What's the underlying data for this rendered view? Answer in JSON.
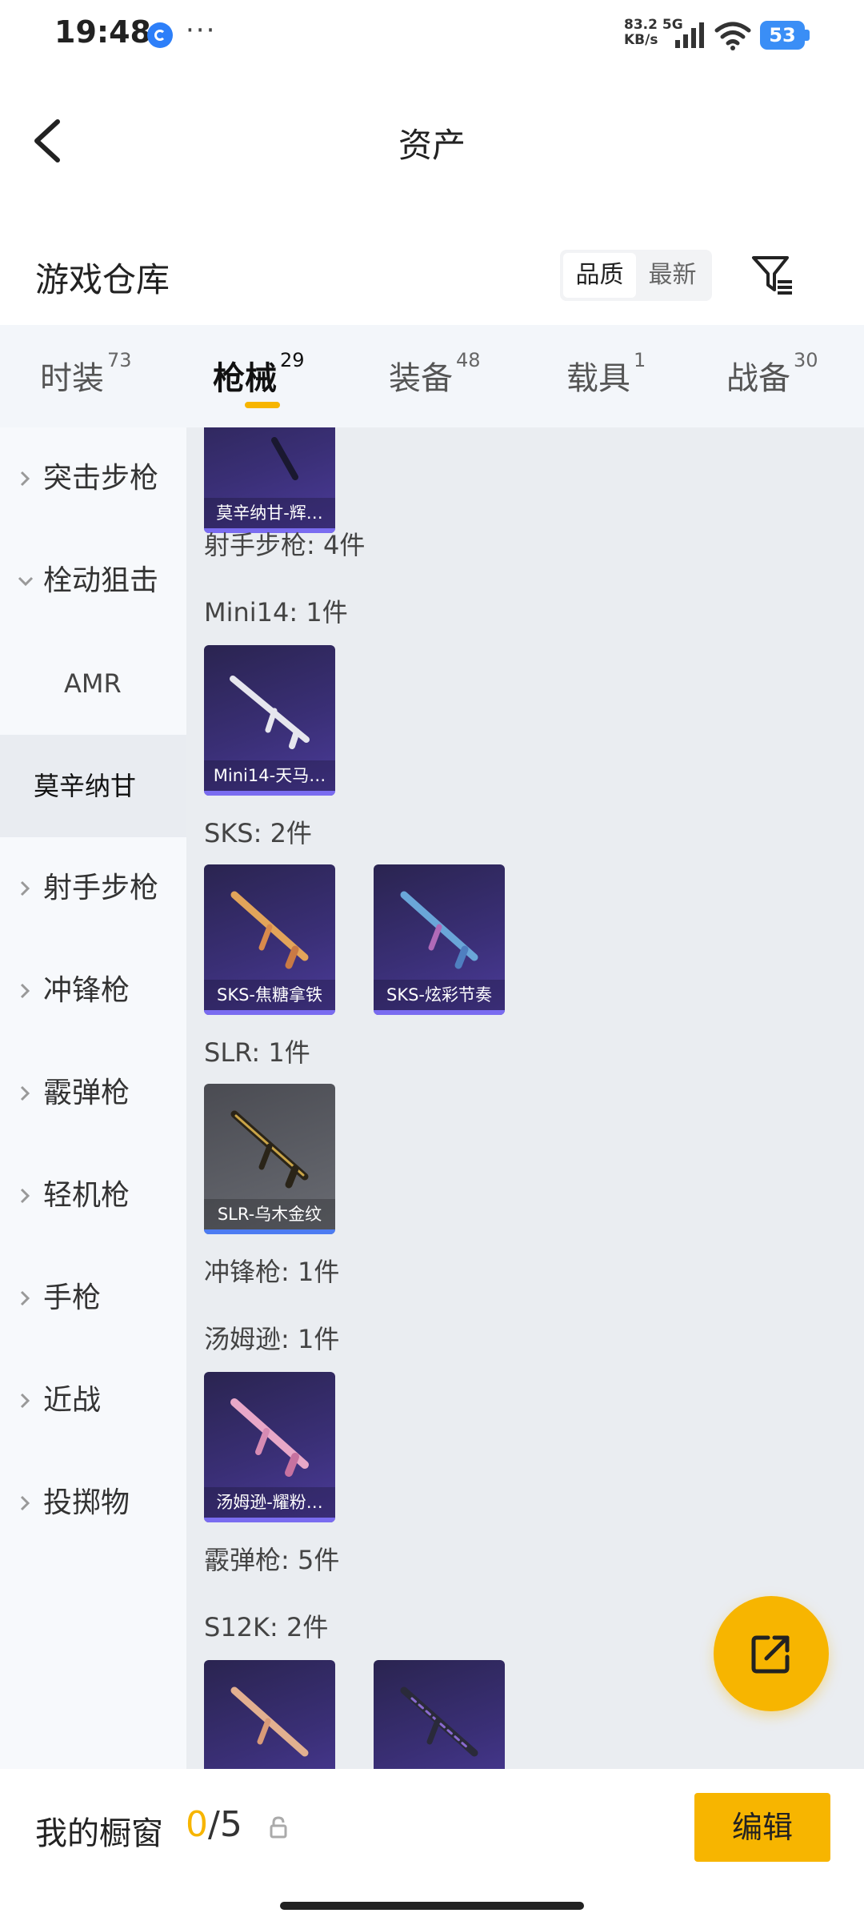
{
  "status_bar": {
    "time": "19:48",
    "more": "···",
    "net_speed_value": "83.2",
    "net_type": "5G",
    "net_unit": "KB/s",
    "battery": "53"
  },
  "header": {
    "title": "资产"
  },
  "warehouse": {
    "title": "游戏仓库",
    "sort_quality": "品质",
    "sort_newest": "最新"
  },
  "tabs": [
    {
      "label": "时装",
      "count": "73"
    },
    {
      "label": "枪械",
      "count": "29"
    },
    {
      "label": "装备",
      "count": "48"
    },
    {
      "label": "载具",
      "count": "1"
    },
    {
      "label": "战备",
      "count": "30"
    }
  ],
  "sidebar": {
    "items": [
      {
        "label": "突击步枪"
      },
      {
        "label": "栓动狙击"
      },
      {
        "label": "AMR"
      },
      {
        "label": "莫辛纳甘"
      },
      {
        "label": "射手步枪"
      },
      {
        "label": "冲锋枪"
      },
      {
        "label": "霰弹枪"
      },
      {
        "label": "轻机枪"
      },
      {
        "label": "手枪"
      },
      {
        "label": "近战"
      },
      {
        "label": "投掷物"
      }
    ]
  },
  "content": {
    "partial_card_name": "莫辛纳甘-辉…",
    "groups": {
      "g1": "射手步枪: 4件",
      "g2": "Mini14: 1件",
      "g3": "SKS: 2件",
      "g4": "SLR: 1件",
      "g5": "冲锋枪: 1件",
      "g6": "汤姆逊: 1件",
      "g7": "霰弹枪: 5件",
      "g8": "S12K: 2件"
    },
    "cards": {
      "mini14": "Mini14-天马…",
      "sks1": "SKS-焦糖拿铁",
      "sks2": "SKS-炫彩节奏",
      "slr": "SLR-乌木金纹",
      "thompson": "汤姆逊-耀粉…"
    }
  },
  "bottom": {
    "showcase_label": "我的橱窗",
    "current": "0",
    "total": "/5",
    "edit_label": "编辑"
  },
  "colors": {
    "accent": "#f7b500",
    "card_purple": "#3a2f76",
    "card_gray": "#5d5f66",
    "selected_bg": "#e9ecf1"
  }
}
